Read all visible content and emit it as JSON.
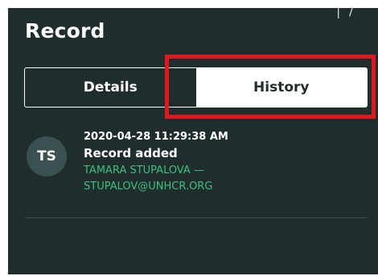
{
  "panel": {
    "title": "Record",
    "corner_glyphs": [
      "|",
      "∕"
    ]
  },
  "tabs": {
    "details_label": "Details",
    "history_label": "History",
    "active": "History"
  },
  "history": {
    "entries": [
      {
        "avatar_initials": "TS",
        "timestamp": "2020-04-28 11:29:38 AM",
        "action": "Record added",
        "user_line1": "TAMARA STUPALOVA —",
        "user_line2": "STUPALOV@UNHCR.ORG"
      }
    ]
  },
  "colors": {
    "panel_bg": "#1f2d2d",
    "highlight": "#e0171c",
    "user_link": "#3fbf7f"
  }
}
